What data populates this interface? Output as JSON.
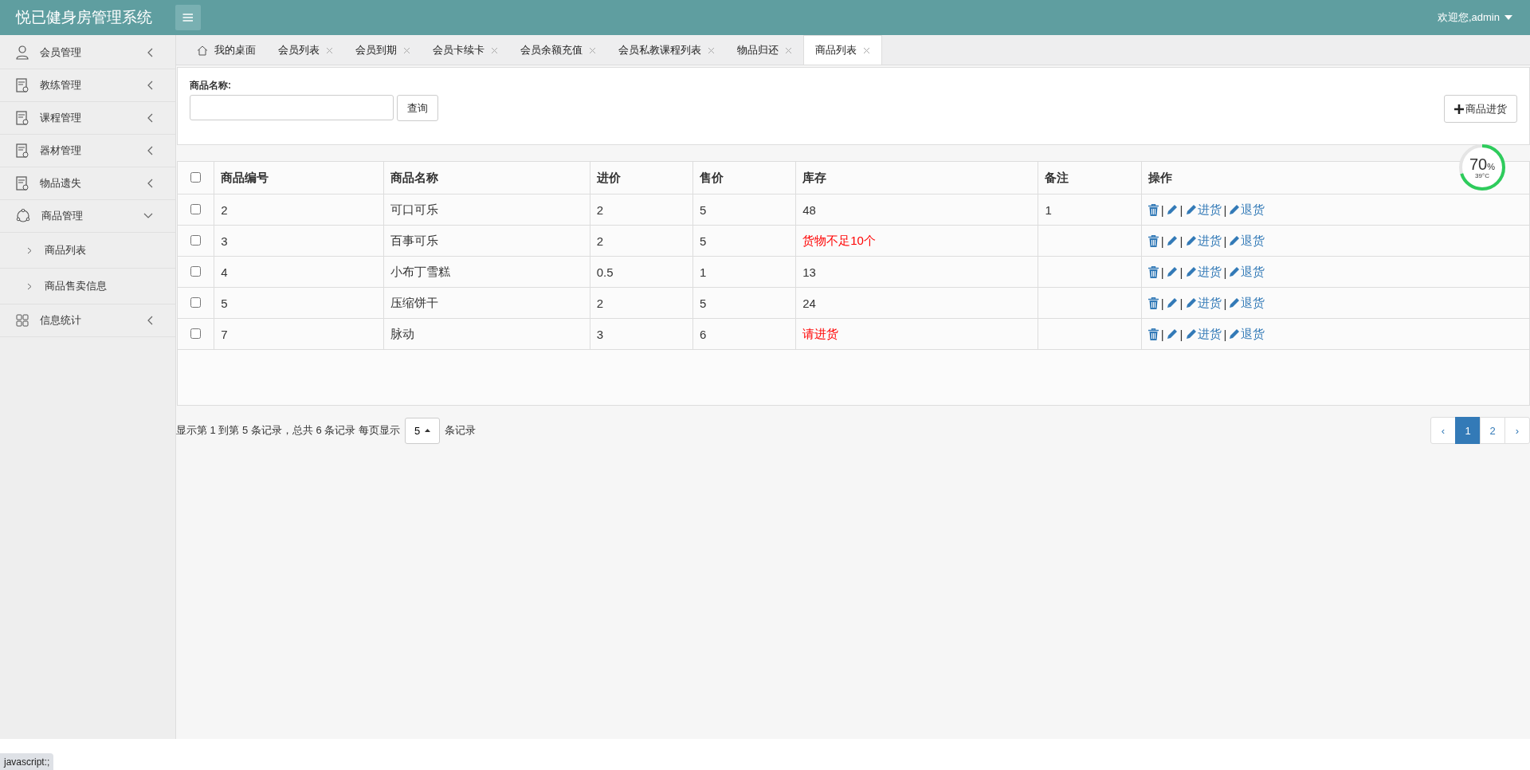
{
  "header": {
    "title": "悦已健身房管理系统",
    "user": "欢迎您,admin"
  },
  "sidebar": {
    "items": [
      {
        "label": "会员管理",
        "kind": "user",
        "expanded": false
      },
      {
        "label": "教练管理",
        "kind": "doc",
        "expanded": false
      },
      {
        "label": "课程管理",
        "kind": "doc",
        "expanded": false
      },
      {
        "label": "器材管理",
        "kind": "doc",
        "expanded": false
      },
      {
        "label": "物品遗失",
        "kind": "doc",
        "expanded": false
      },
      {
        "label": "商品管理",
        "kind": "goods",
        "expanded": true,
        "children": [
          {
            "label": "商品列表"
          },
          {
            "label": "商品售卖信息"
          }
        ]
      },
      {
        "label": "信息统计",
        "kind": "grid",
        "expanded": false
      }
    ]
  },
  "tabs": [
    {
      "label": "我的桌面",
      "kind": "home",
      "selected": false
    },
    {
      "label": "会员列表",
      "kind": "closable",
      "selected": false
    },
    {
      "label": "会员到期",
      "kind": "closable",
      "selected": false
    },
    {
      "label": "会员卡续卡",
      "kind": "closable",
      "selected": false
    },
    {
      "label": "会员余额充值",
      "kind": "closable",
      "selected": false
    },
    {
      "label": "会员私教课程列表",
      "kind": "closable",
      "selected": false
    },
    {
      "label": "物品归还",
      "kind": "closable",
      "selected": false
    },
    {
      "label": "商品列表",
      "kind": "closable",
      "selected": true
    }
  ],
  "search": {
    "label": "商品名称:",
    "button": "查询",
    "add_button": "商品进货"
  },
  "table": {
    "columns": [
      "商品编号",
      "商品名称",
      "进价",
      "售价",
      "库存",
      "备注",
      "操作"
    ],
    "rows": [
      {
        "checked": false,
        "id": "2",
        "name": "可口可乐",
        "cost": "2",
        "price": "5",
        "stock": "48",
        "stock_warning": false,
        "note": "1",
        "actions": [
          {
            "kind": "delete"
          },
          {
            "kind": "edit"
          },
          {
            "kind": "link",
            "label": "进货"
          },
          {
            "kind": "link",
            "label": "退货"
          }
        ]
      },
      {
        "checked": false,
        "id": "3",
        "name": "百事可乐",
        "cost": "2",
        "price": "5",
        "stock": "货物不足10个",
        "stock_warning": true,
        "note": "",
        "actions": [
          {
            "kind": "delete"
          },
          {
            "kind": "edit"
          },
          {
            "kind": "link",
            "label": "进货"
          },
          {
            "kind": "link",
            "label": "退货"
          }
        ]
      },
      {
        "checked": false,
        "id": "4",
        "name": "小布丁雪糕",
        "cost": "0.5",
        "price": "1",
        "stock": "13",
        "stock_warning": false,
        "note": "",
        "actions": [
          {
            "kind": "delete"
          },
          {
            "kind": "edit"
          },
          {
            "kind": "link",
            "label": "进货"
          },
          {
            "kind": "link",
            "label": "退货"
          }
        ]
      },
      {
        "checked": false,
        "id": "5",
        "name": "压缩饼干",
        "cost": "2",
        "price": "5",
        "stock": "24",
        "stock_warning": false,
        "note": "",
        "actions": [
          {
            "kind": "delete"
          },
          {
            "kind": "edit"
          },
          {
            "kind": "link",
            "label": "进货"
          },
          {
            "kind": "link",
            "label": "退货"
          }
        ]
      },
      {
        "checked": false,
        "id": "7",
        "name": "脉动",
        "cost": "3",
        "price": "6",
        "stock": "请进货",
        "stock_warning": true,
        "note": "",
        "actions": [
          {
            "kind": "delete"
          },
          {
            "kind": "edit"
          },
          {
            "kind": "link",
            "label": "进货"
          },
          {
            "kind": "link",
            "label": "退货"
          }
        ]
      }
    ],
    "select_all_checked": false,
    "action_separator": "|"
  },
  "pagination": {
    "info": "显示第 1 到第 5 条记录，总共 6 条记录 每页显示",
    "page_size": "5",
    "suffix": "条记录",
    "prev": "‹",
    "next": "›",
    "pages": [
      {
        "label": "1",
        "selected": true
      },
      {
        "label": "2",
        "selected": false
      }
    ]
  },
  "monitor": {
    "value": "70",
    "unit": "%",
    "temp": "39°C",
    "level": 0.7
  },
  "status_bar": "javascript:;"
}
